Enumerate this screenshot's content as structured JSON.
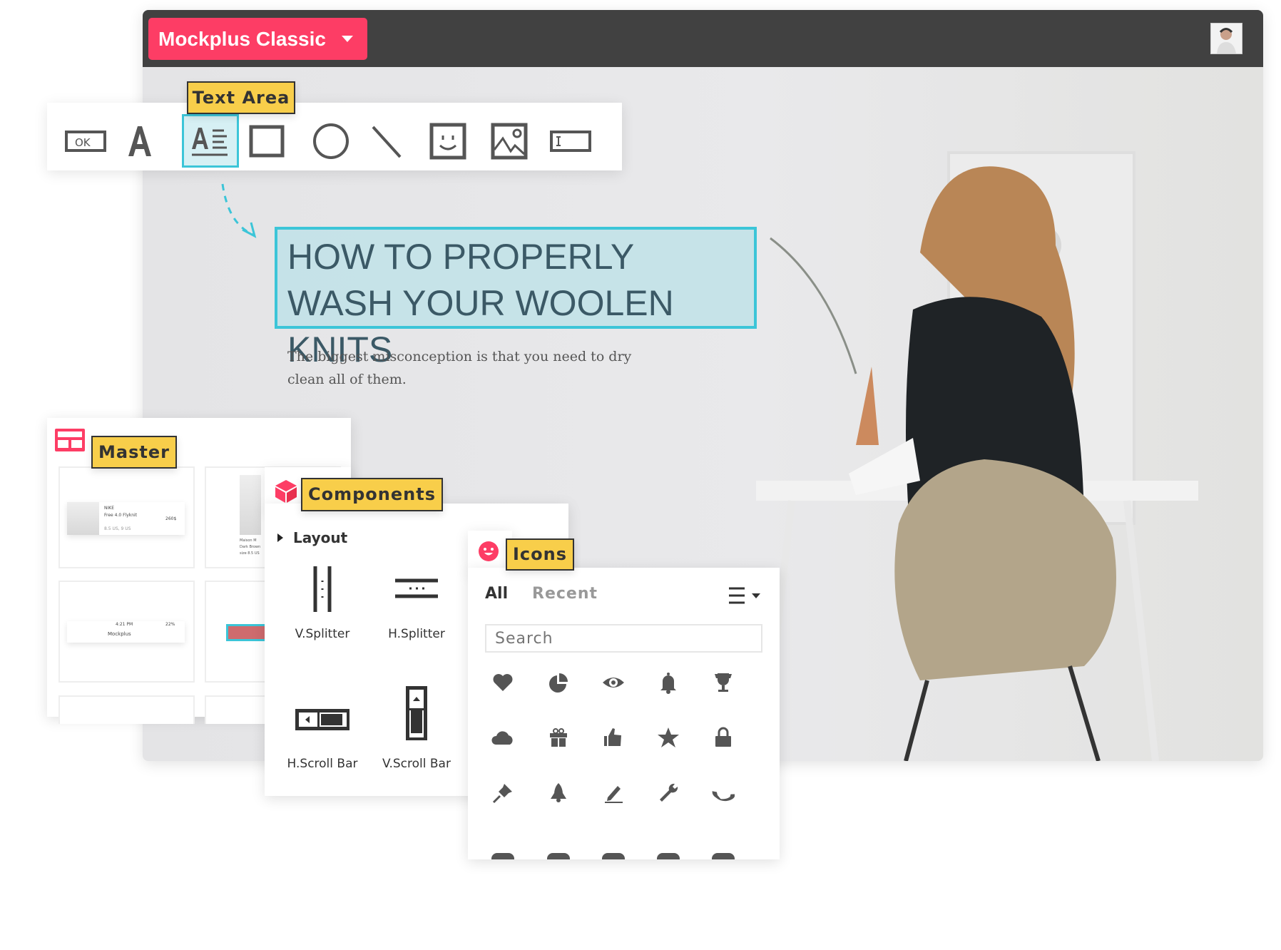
{
  "app": {
    "title": "Mockplus Classic",
    "avatar": "user-avatar"
  },
  "toolbar": {
    "tooltip": "Text Area",
    "tools": [
      {
        "name": "button",
        "label": "OK"
      },
      {
        "name": "label"
      },
      {
        "name": "text-area",
        "selected": true
      },
      {
        "name": "rectangle"
      },
      {
        "name": "circle"
      },
      {
        "name": "line"
      },
      {
        "name": "icon"
      },
      {
        "name": "image"
      },
      {
        "name": "text-input"
      }
    ]
  },
  "canvas": {
    "headline": "HOW TO PROPERLY WASH YOUR WOOLEN KNITS",
    "body": "The biggest misconception is that you need to dry clean all of them."
  },
  "master": {
    "label": "Master",
    "thumbs": [
      {
        "brand": "NIKE",
        "product": "Free 4.0 Flyknit",
        "price": "260$",
        "size": "8.5 US, 9 US"
      },
      {
        "brand": "Maison M",
        "product": "Dark Brown",
        "size": "size 8.5 US"
      },
      {
        "time": "4:21 PM",
        "title": "Mockplus",
        "battery": "22%"
      }
    ]
  },
  "components": {
    "label": "Components",
    "section": "Layout",
    "items": [
      "V.Splitter",
      "H.Splitter",
      "H.Scroll Bar",
      "V.Scroll Bar"
    ]
  },
  "icons": {
    "label": "Icons",
    "tabs": [
      "All",
      "Recent"
    ],
    "search_placeholder": "Search",
    "grid": [
      "heart",
      "pie-chart",
      "eye",
      "bell",
      "trophy",
      "cloud",
      "gift",
      "thumbs-up",
      "star",
      "lock",
      "pin",
      "rocket",
      "pencil",
      "wrench",
      "phone"
    ]
  },
  "colors": {
    "brand": "#fd3d65",
    "accent": "#3cc5d8",
    "tooltip": "#f8ce4a",
    "titlebar": "#414141"
  }
}
